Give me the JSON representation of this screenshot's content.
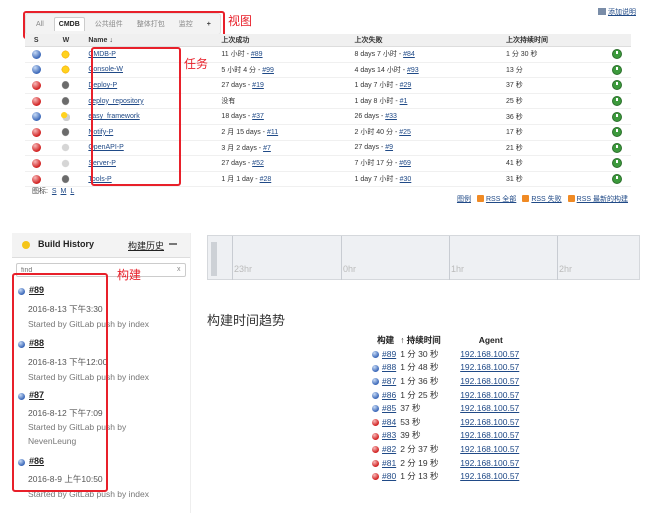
{
  "view_tabs": [
    {
      "label": "All",
      "active": false
    },
    {
      "label": "CMDB",
      "active": true
    },
    {
      "label": "公共组件",
      "active": false
    },
    {
      "label": "整体打包",
      "active": false
    },
    {
      "label": "监控",
      "active": false
    },
    {
      "label": "+",
      "active": false
    }
  ],
  "add_description": "添加说明",
  "annotations": {
    "view": "视图",
    "task": "任务",
    "build": "构建"
  },
  "jobs_table": {
    "headers": {
      "s": "S",
      "w": "W",
      "name": "Name ↓",
      "last_success": "上次成功",
      "last_failure": "上次失败",
      "last_duration": "上次持续时间"
    },
    "rows": [
      {
        "status": "blue",
        "weather": "sun",
        "name": "CMDB-P",
        "last_success_prefix": "11 小时 - ",
        "last_success_link": "#89",
        "last_failure_prefix": "8 days 7 小时 - ",
        "last_failure_link": "#84",
        "duration": "1 分 30 秒"
      },
      {
        "status": "blue",
        "weather": "sun",
        "name": "Console-W",
        "last_success_prefix": "5 小时 4 分 - ",
        "last_success_link": "#99",
        "last_failure_prefix": "4 days 14 小时 - ",
        "last_failure_link": "#93",
        "duration": "13 分"
      },
      {
        "status": "red",
        "weather": "storm",
        "name": "Deploy-P",
        "last_success_prefix": "27 days - ",
        "last_success_link": "#19",
        "last_failure_prefix": "1 day 7 小时 - ",
        "last_failure_link": "#29",
        "duration": "37 秒"
      },
      {
        "status": "red",
        "weather": "storm",
        "name": "deploy_repository",
        "last_success_prefix": "没有",
        "last_success_link": "",
        "last_failure_prefix": "1 day 8 小时 - ",
        "last_failure_link": "#1",
        "duration": "25 秒"
      },
      {
        "status": "blue",
        "weather": "suncloud",
        "name": "easy_framework",
        "last_success_prefix": "18 days - ",
        "last_success_link": "#37",
        "last_failure_prefix": "26 days - ",
        "last_failure_link": "#33",
        "duration": "36 秒"
      },
      {
        "status": "red",
        "weather": "storm",
        "name": "Notify-P",
        "last_success_prefix": "2 月 15 days - ",
        "last_success_link": "#11",
        "last_failure_prefix": "2 小时 40 分 - ",
        "last_failure_link": "#25",
        "duration": "17 秒"
      },
      {
        "status": "red",
        "weather": "cloud",
        "name": "OpenAPI-P",
        "last_success_prefix": "3 月 2 days - ",
        "last_success_link": "#7",
        "last_failure_prefix": "27 days - ",
        "last_failure_link": "#9",
        "duration": "21 秒"
      },
      {
        "status": "red",
        "weather": "cloud",
        "name": "Server-P",
        "last_success_prefix": "27 days - ",
        "last_success_link": "#52",
        "last_failure_prefix": "7 小时 17 分 - ",
        "last_failure_link": "#69",
        "duration": "41 秒"
      },
      {
        "status": "red",
        "weather": "storm",
        "name": "Tools-P",
        "last_success_prefix": "1 月 1 day - ",
        "last_success_link": "#28",
        "last_failure_prefix": "1 day 7 小时 - ",
        "last_failure_link": "#30",
        "duration": "31 秒"
      }
    ]
  },
  "icon_size": {
    "label": "图标:",
    "s": "S",
    "m": "M",
    "l": "L"
  },
  "rss": {
    "legend": "图例",
    "all": "RSS 全部",
    "failures": "RSS 失败",
    "latest": "RSS 最新的构建"
  },
  "build_history": {
    "title": "Build History",
    "trend_link": "构建历史",
    "filter_placeholder": "find",
    "filter_clear": "x",
    "entries": [
      {
        "status": "blue",
        "number": "#89",
        "date": "2016-8-13 下午3:30",
        "started_line1": "Started by GitLab push by index",
        "started_line2": ""
      },
      {
        "status": "blue",
        "number": "#88",
        "date": "2016-8-13 下午12:00",
        "started_line1": "Started by GitLab push by index",
        "started_line2": ""
      },
      {
        "status": "blue",
        "number": "#87",
        "date": "2016-8-12 下午7:09",
        "started_line1": "Started by GitLab push by",
        "started_line2": "NevenLeung"
      },
      {
        "status": "blue",
        "number": "#86",
        "date": "2016-8-9 上午10:50",
        "started_line1": "Started by GitLab push by index",
        "started_line2": ""
      }
    ]
  },
  "timeline": {
    "labels": [
      "23hr",
      "0hr",
      "1hr",
      "2hr"
    ]
  },
  "build_trend": {
    "title": "构建时间趋势",
    "headers": {
      "build": "构建",
      "duration": "↑ 持续时间",
      "agent": "Agent"
    },
    "rows": [
      {
        "status": "blue",
        "build": "#89",
        "duration": "1 分 30 秒",
        "agent": "192.168.100.57"
      },
      {
        "status": "blue",
        "build": "#88",
        "duration": "1 分 48 秒",
        "agent": "192.168.100.57"
      },
      {
        "status": "blue",
        "build": "#87",
        "duration": "1 分 36 秒",
        "agent": "192.168.100.57"
      },
      {
        "status": "blue",
        "build": "#86",
        "duration": "1 分 25 秒",
        "agent": "192.168.100.57"
      },
      {
        "status": "blue",
        "build": "#85",
        "duration": "37 秒",
        "agent": "192.168.100.57"
      },
      {
        "status": "red",
        "build": "#84",
        "duration": "53 秒",
        "agent": "192.168.100.57"
      },
      {
        "status": "red",
        "build": "#83",
        "duration": "39 秒",
        "agent": "192.168.100.57"
      },
      {
        "status": "red",
        "build": "#82",
        "duration": "2 分 37 秒",
        "agent": "192.168.100.57"
      },
      {
        "status": "red",
        "build": "#81",
        "duration": "2 分 19 秒",
        "agent": "192.168.100.57"
      },
      {
        "status": "red",
        "build": "#80",
        "duration": "1 分 13 秒",
        "agent": "192.168.100.57"
      }
    ]
  }
}
